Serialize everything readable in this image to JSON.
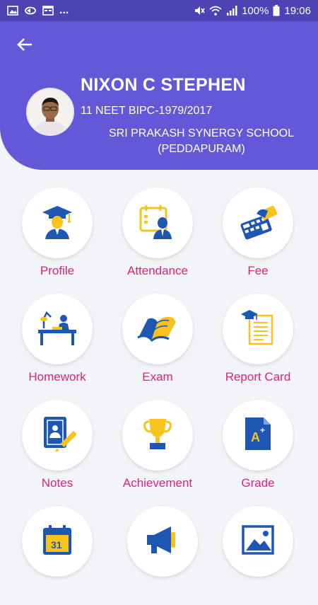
{
  "status_bar": {
    "dots": "...",
    "battery_text": "100%",
    "time": "19:06",
    "icons": [
      "gallery-icon",
      "sync-icon",
      "calendar-icon",
      "mute-icon",
      "wifi-icon",
      "signal-icon",
      "battery-icon"
    ]
  },
  "header": {
    "student_name": "NIXON C STEPHEN",
    "course": "11 NEET BIPC-1979/2017",
    "school_line1": "SRI PRAKASH SYNERGY SCHOOL",
    "school_line2": "(PEDDAPURAM)",
    "back_icon": "arrow-left-icon"
  },
  "menu": {
    "items": [
      {
        "label": "Profile",
        "icon": "graduate-icon"
      },
      {
        "label": "Attendance",
        "icon": "attendance-icon"
      },
      {
        "label": "Fee",
        "icon": "calculator-cash-icon"
      },
      {
        "label": "Homework",
        "icon": "desk-study-icon"
      },
      {
        "label": "Exam",
        "icon": "open-book-icon"
      },
      {
        "label": "Report Card",
        "icon": "report-card-icon"
      },
      {
        "label": "Notes",
        "icon": "notes-pencil-icon"
      },
      {
        "label": "Achievement",
        "icon": "trophy-icon"
      },
      {
        "label": "Grade",
        "icon": "grade-icon"
      },
      {
        "label": "",
        "icon": "calendar-31-icon"
      },
      {
        "label": "",
        "icon": "megaphone-icon"
      },
      {
        "label": "",
        "icon": "gallery-image-icon"
      }
    ]
  },
  "colors": {
    "header": "#6358d7",
    "status_bar": "#4d43b5",
    "label": "#e0217a",
    "icon_blue": "#1e56b4",
    "icon_yellow": "#f7c31c"
  }
}
